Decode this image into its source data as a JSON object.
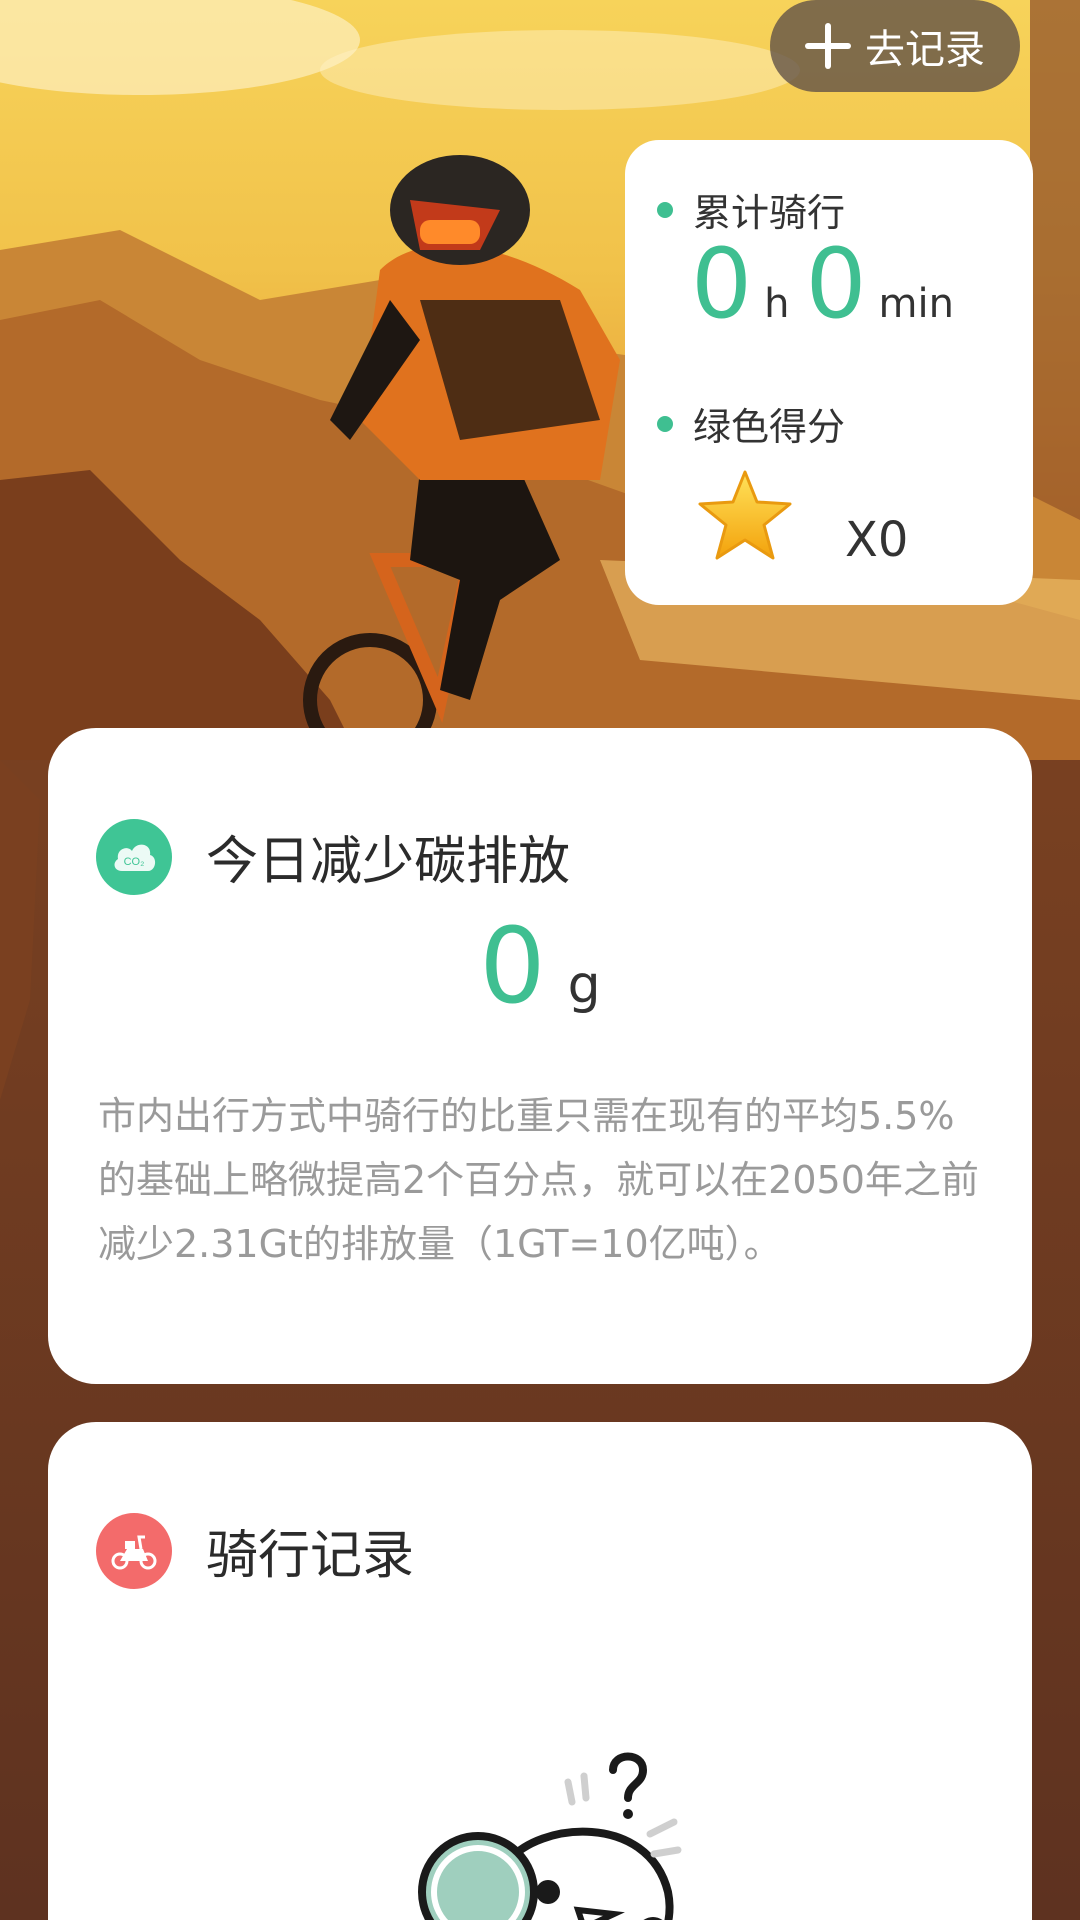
{
  "header": {
    "record_button_label": "去记录"
  },
  "stats": {
    "total_ride_label": "累计骑行",
    "hours_value": "0",
    "hours_unit": "h",
    "minutes_value": "0",
    "minutes_unit": "min",
    "green_score_label": "绿色得分",
    "star_count": "X0"
  },
  "carbon": {
    "title": "今日减少碳排放",
    "value": "0",
    "unit": "g",
    "description": "市内出行方式中骑行的比重只需在现有的平均5.5%的基础上略微提高2个百分点，就可以在2050年之前减少2.31Gt的排放量（1GT=10亿吨）。",
    "icon_text": "CO₂"
  },
  "records": {
    "title": "骑行记录"
  },
  "colors": {
    "accent_green": "#3fbf91",
    "carbon_icon_bg": "#3fc595",
    "records_icon_bg": "#f36b6b",
    "text_dark": "#2b2b2b",
    "text_muted": "#9a9a9a"
  },
  "icons": {
    "record_button": "plus-icon",
    "stat_bullets": "dot-icon",
    "score": "star-icon",
    "carbon": "co2-cloud-icon",
    "records": "scooter-icon",
    "empty_state": "magnifier-mascot-illustration"
  }
}
